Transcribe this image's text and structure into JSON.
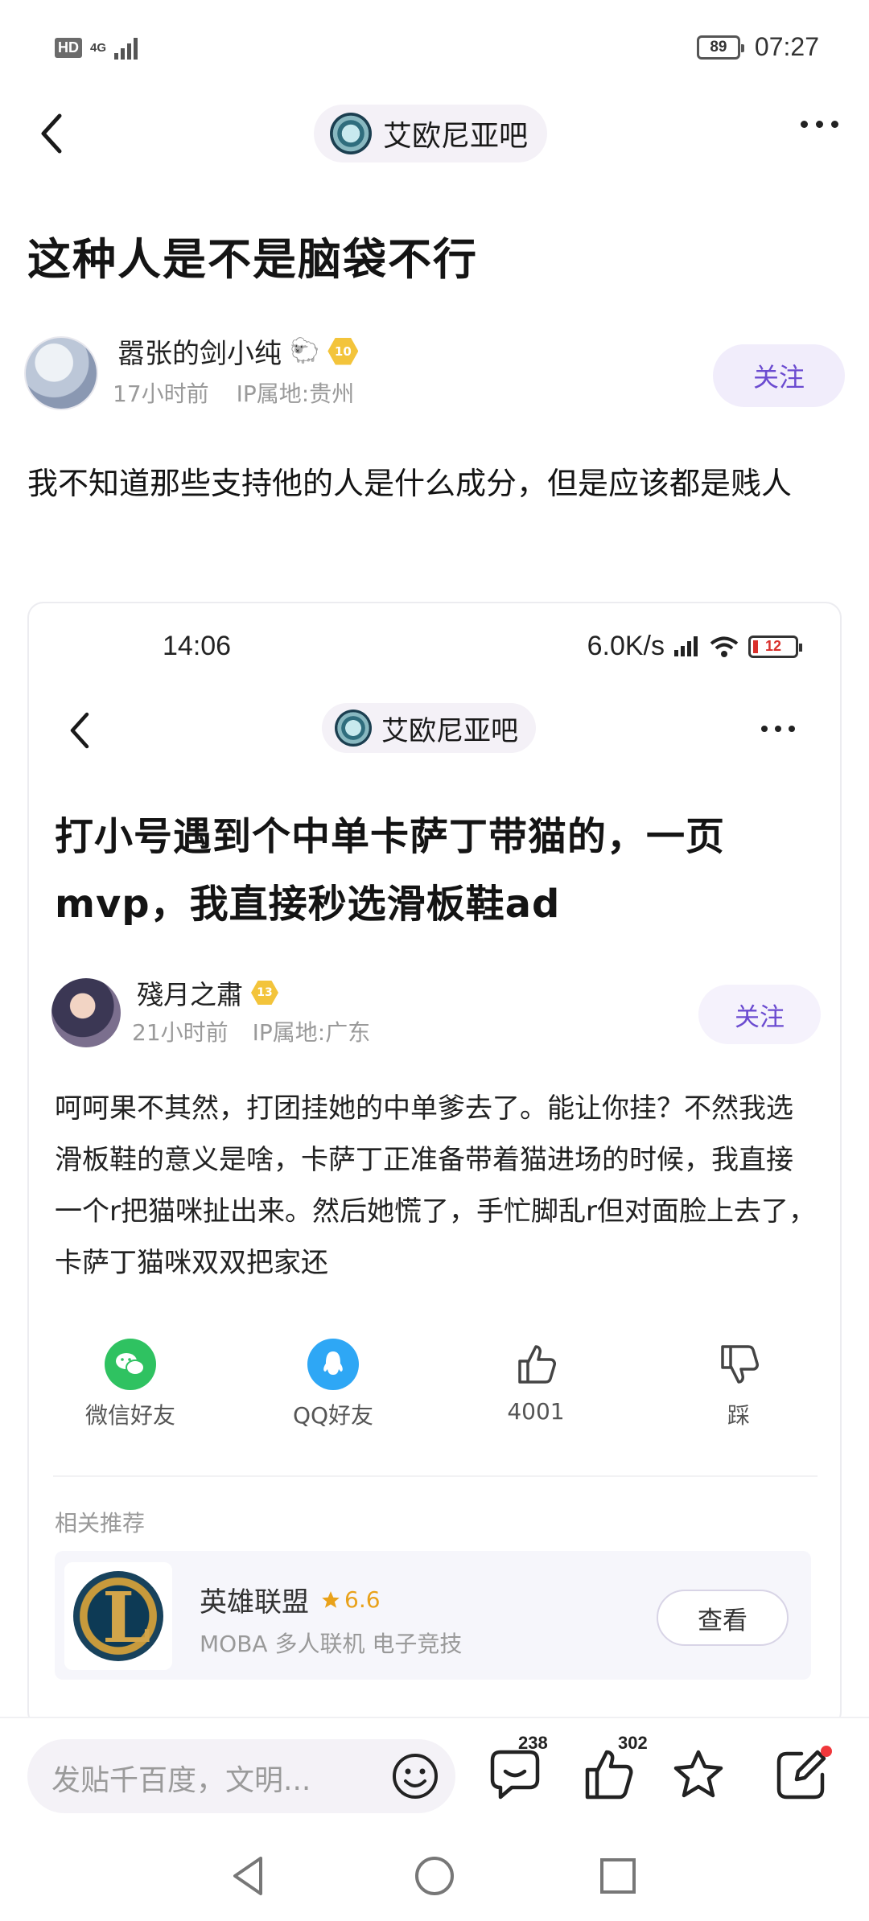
{
  "status_bar": {
    "hd": "HD",
    "network": "4G",
    "battery": "89",
    "time": "07:27"
  },
  "nav": {
    "forum_name": "艾欧尼亚吧"
  },
  "post": {
    "title": "这种人是不是脑袋不行",
    "author": "嚣张的剑小纯",
    "author_emoji": "🐑",
    "level": "10",
    "time_ago": "17小时前",
    "ip": "IP属地:贵州",
    "follow_label": "关注",
    "body": "我不知道那些支持他的人是什么成分，但是应该都是贱人"
  },
  "screenshot": {
    "status": {
      "time": "14:06",
      "speed": "6.0K/s",
      "battery": "12"
    },
    "forum_name": "艾欧尼亚吧",
    "title": "打小号遇到个中单卡萨丁带猫的，一页mvp，我直接秒选滑板鞋ad",
    "author": "殘月之肅",
    "level": "13",
    "time_ago": "21小时前",
    "ip": "IP属地:广东",
    "follow_label": "关注",
    "body": "呵呵果不其然，打团挂她的中单爹去了。能让你挂？不然我选滑板鞋的意义是啥，卡萨丁正准备带着猫进场的时候，我直接一个r把猫咪扯出来。然后她慌了，手忙脚乱r但对面脸上去了，卡萨丁猫咪双双把家还",
    "share": [
      {
        "label": "微信好友",
        "icon": "wechat-icon"
      },
      {
        "label": "QQ好友",
        "icon": "qq-icon"
      },
      {
        "label": "4001",
        "icon": "thumbs-up-icon"
      },
      {
        "label": "踩",
        "icon": "thumbs-down-icon"
      }
    ],
    "related_title": "相关推荐",
    "app": {
      "name": "英雄联盟",
      "rating": "6.6",
      "tags": "MOBA 多人联机 电子竞技",
      "view_label": "查看"
    }
  },
  "bottom_bar": {
    "input_placeholder": "发贴千百度，文明...",
    "comment_count": "238",
    "like_count": "302"
  },
  "colors": {
    "accent": "#6b4bd0",
    "follow_bg": "#f1edfb",
    "star": "#e9a21a",
    "wechat": "#2fc261",
    "qq": "#2ea7f5",
    "notice_dot": "#f0373b"
  }
}
